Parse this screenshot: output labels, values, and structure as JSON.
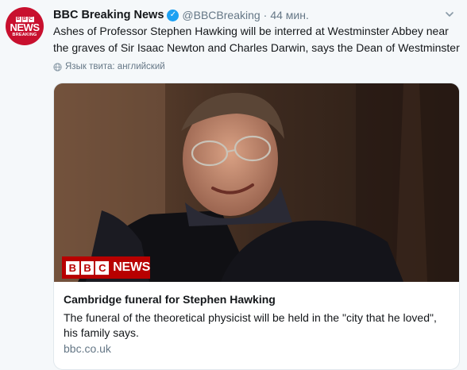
{
  "tweet": {
    "author_name": "BBC Breaking News",
    "handle": "@BBCBreaking",
    "separator": "·",
    "time": "44 мин.",
    "text": "Ashes of Professor Stephen Hawking will be interred at Westminster Abbey near the graves of Sir Isaac Newton and Charles Darwin, says the Dean of Westminster",
    "translate_note": "Язык твита: английский",
    "verified_glyph": "✓"
  },
  "avatar": {
    "letters": [
      "B",
      "B",
      "C"
    ],
    "line1": "NEWS",
    "line2": "BREAKING"
  },
  "card": {
    "image_logo_letters": [
      "B",
      "B",
      "C"
    ],
    "image_logo_word": "NEWS",
    "title": "Cambridge funeral for Stephen Hawking",
    "description": "The funeral of the theoretical physicist will be held in the \"city that he loved\", his family says.",
    "domain": "bbc.co.uk"
  },
  "icons": {
    "verified": "verified-badge-icon",
    "caret": "chevron-down-icon",
    "globe": "globe-icon"
  },
  "colors": {
    "bbc_red": "#c8102e",
    "twitter_blue": "#1da1f2",
    "muted": "#657786"
  }
}
